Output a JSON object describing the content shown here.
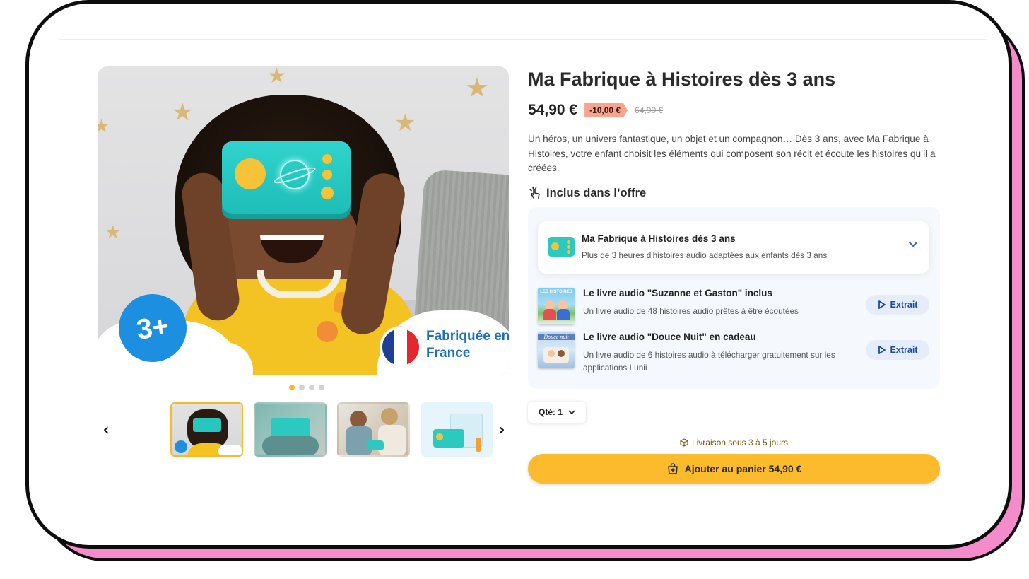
{
  "product": {
    "title": "Ma Fabrique à Histoires dès 3 ans",
    "price": "54,90 €",
    "discount": "-10,00 €",
    "old_price": "64,90 €",
    "description": "Un héros, un univers fantastique, un objet et un compagnon… Dès 3 ans, avec Ma Fabrique à Histoires, votre enfant choisit les éléments qui composent son récit et écoute les histoires qu’il a créées."
  },
  "gallery": {
    "age_badge": "3+",
    "made_in_label": "Fabriquée en France",
    "slide_count": 4,
    "active_slide": 1,
    "prev_icon": "chevron-left-icon",
    "next_icon": "chevron-right-icon"
  },
  "included": {
    "heading": "Inclus dans l’offre",
    "icon": "hand-pointer-icon",
    "main_item": {
      "title": "Ma Fabrique à Histoires dès 3 ans",
      "subtitle": "Plus de 3 heures d'histoires audio adaptées aux enfants dès 3 ans"
    },
    "books": [
      {
        "title": "Le livre audio \"Suzanne et Gaston\" inclus",
        "subtitle": "Un livre audio de 48 histoires audio prêtes à être écoutées",
        "cover_text": "LES HISTOIRES",
        "button": "Extrait"
      },
      {
        "title": "Le livre audio \"Douce Nuit\" en cadeau",
        "subtitle": "Un livre audio de 6 histoires audio à télécharger gratuitement sur les applications Lunii",
        "cover_text": "Douce nuit",
        "button": "Extrait"
      }
    ]
  },
  "purchase": {
    "quantity": "Qté: 1",
    "delivery": "Livraison sous 3 à 5 jours",
    "cart_button": "Ajouter au panier 54,90 €"
  },
  "colors": {
    "accent_yellow": "#fbbb2c",
    "discount_bg": "#f6a48d",
    "link_blue": "#1f4e9c",
    "frame_pink": "#f48ccc"
  }
}
